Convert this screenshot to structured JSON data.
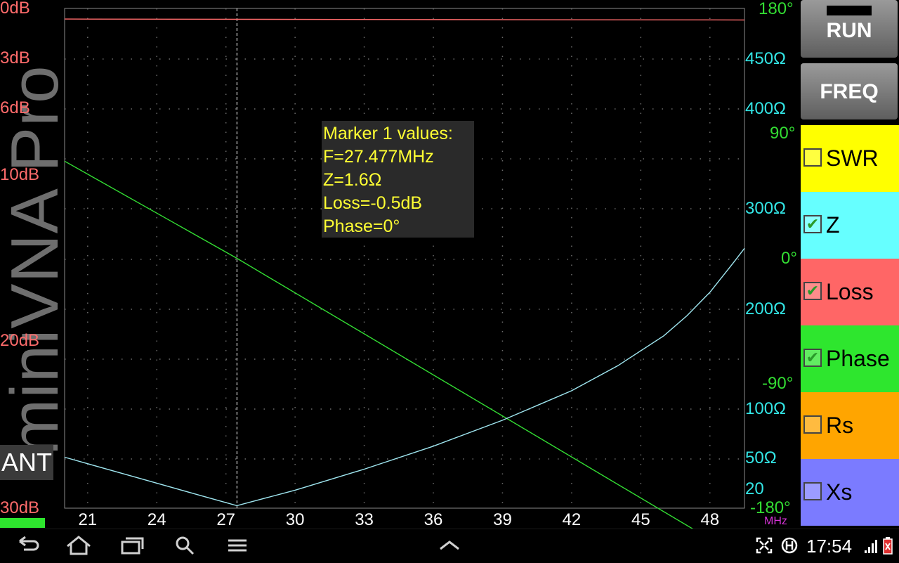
{
  "app": {
    "watermark": "miniVNA Pro",
    "mode_badge": "ANT"
  },
  "marker": {
    "title": "Marker 1 values:",
    "freq": "F=27.477MHz",
    "z": "Z=1.6Ω",
    "loss": "Loss=-0.5dB",
    "phase": "Phase=0°"
  },
  "chart_data": {
    "type": "line",
    "x_unit": "MHz",
    "x_range": [
      20,
      49.5
    ],
    "x_ticks": [
      "21",
      "24",
      "27",
      "30",
      "33",
      "36",
      "39",
      "42",
      "45",
      "48"
    ],
    "marker_x": 27.477,
    "loss_axis": {
      "labels": [
        "0dB",
        "3dB",
        "6dB",
        "10dB",
        "20dB",
        "30dB"
      ],
      "color": "#ff6b6b"
    },
    "phase_axis": {
      "labels": [
        "180°",
        "90°",
        "0°",
        "-90°",
        "-180°"
      ],
      "color": "#33dd33",
      "range": [
        -180,
        180
      ]
    },
    "z_axis": {
      "labels": [
        "450Ω",
        "400Ω",
        "300Ω",
        "200Ω",
        "100Ω",
        "50Ω",
        "20"
      ],
      "color": "#33e6e6"
    },
    "series": [
      {
        "name": "Loss",
        "color": "#ff6b6b",
        "x": [
          20,
          35,
          49.5
        ],
        "y_db": [
          0.3,
          0.5,
          0.7
        ]
      },
      {
        "name": "Phase",
        "color": "#33dd33",
        "x": [
          20,
          27.477,
          49.5
        ],
        "y_deg": [
          70,
          0,
          -217
        ]
      },
      {
        "name": "Z",
        "color": "#9fe6f0",
        "x": [
          20,
          23,
          26,
          27.477,
          30,
          33,
          36,
          39,
          42,
          44,
          46,
          47,
          48,
          49,
          49.5
        ],
        "y_norm": [
          0.102,
          0.063,
          0.024,
          0.005,
          0.036,
          0.078,
          0.124,
          0.176,
          0.235,
          0.285,
          0.345,
          0.385,
          0.432,
          0.49,
          0.52
        ]
      }
    ]
  },
  "panel": {
    "run_label": "RUN",
    "freq_label": "FREQ",
    "traces": [
      {
        "label": "SWR",
        "bg": "#ffff00",
        "checked": false
      },
      {
        "label": "Z",
        "bg": "#66ffff",
        "checked": true
      },
      {
        "label": "Loss",
        "bg": "#ff6666",
        "checked": true
      },
      {
        "label": "Phase",
        "bg": "#2ee62e",
        "checked": true
      },
      {
        "label": "Rs",
        "bg": "#ffa500",
        "checked": false
      },
      {
        "label": "Xs",
        "bg": "#7b7bff",
        "checked": false
      }
    ]
  },
  "statusbar": {
    "time": "17:54",
    "icons": [
      "back-icon",
      "home-icon",
      "recent-apps-icon",
      "search-icon",
      "menu-icon",
      "chevron-up-icon",
      "fullscreen-icon",
      "data-sync-icon",
      "signal-icon",
      "battery-icon"
    ]
  }
}
